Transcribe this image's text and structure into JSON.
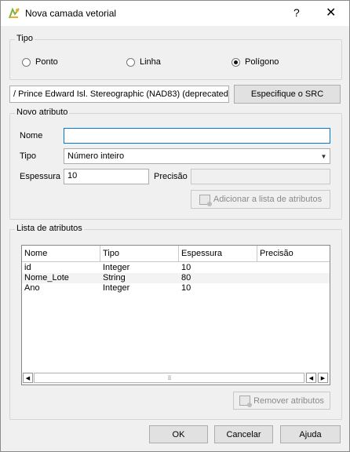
{
  "window": {
    "title": "Nova camada vetorial",
    "help": "?",
    "close": "✕"
  },
  "tipo": {
    "label": "Tipo",
    "options": [
      {
        "label": "Ponto",
        "checked": false
      },
      {
        "label": "Linha",
        "checked": false
      },
      {
        "label": "Polígono",
        "checked": true
      }
    ]
  },
  "crs": {
    "value": "/ Prince Edward Isl. Stereographic (NAD83) (deprecated)",
    "button": "Especifique o SRC"
  },
  "novo_atributo": {
    "label": "Novo atributo",
    "nome_label": "Nome",
    "nome_value": "",
    "tipo_label": "Tipo",
    "tipo_value": "Número inteiro",
    "espessura_label": "Espessura",
    "espessura_value": "10",
    "precisao_label": "Precisão",
    "precisao_value": "",
    "add_button": "Adicionar a lista de atributos"
  },
  "lista": {
    "label": "Lista de atributos",
    "columns": [
      "Nome",
      "Tipo",
      "Espessura",
      "Precisão"
    ],
    "rows": [
      [
        "id",
        "Integer",
        "10",
        ""
      ],
      [
        "Nome_Lote",
        "String",
        "80",
        ""
      ],
      [
        "Ano",
        "Integer",
        "10",
        ""
      ]
    ],
    "remove_button": "Remover atributos"
  },
  "footer": {
    "ok": "OK",
    "cancel": "Cancelar",
    "help": "Ajuda"
  }
}
